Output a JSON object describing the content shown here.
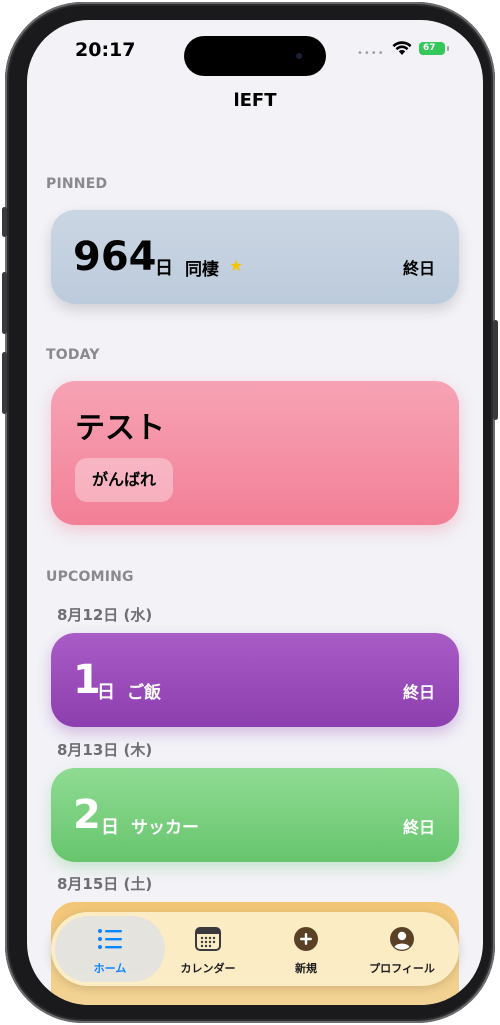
{
  "status": {
    "time": "20:17",
    "battery": "67"
  },
  "nav": {
    "title": "lEFT"
  },
  "pinned": {
    "section": "PINNED",
    "card": {
      "number": "964",
      "unit": "日",
      "title": "同棲",
      "all_day": "終日"
    }
  },
  "today": {
    "section": "TODAY",
    "card": {
      "title": "テスト",
      "chip": "がんばれ"
    }
  },
  "upcoming": {
    "section": "UPCOMING",
    "groups": [
      {
        "date": "8月12日 (水)",
        "number": "1",
        "unit": "日",
        "title": "ご飯",
        "all_day": "終日"
      },
      {
        "date": "8月13日 (木)",
        "number": "2",
        "unit": "日",
        "title": "サッカー",
        "all_day": "終日"
      },
      {
        "date": "8月15日 (土)"
      }
    ]
  },
  "tabs": [
    {
      "label": "ホーム",
      "icon": "list-icon",
      "active": true
    },
    {
      "label": "カレンダー",
      "icon": "calendar-icon"
    },
    {
      "label": "新規",
      "icon": "plus-circle-icon"
    },
    {
      "label": "プロフィール",
      "icon": "person-circle-icon"
    }
  ],
  "colors": {
    "pinned": "#c6d2e0",
    "today": "#f58fa5",
    "purple": "#9b4dbb",
    "green": "#79d17e",
    "orange": "#f3c676",
    "accent": "#0a84ff"
  }
}
